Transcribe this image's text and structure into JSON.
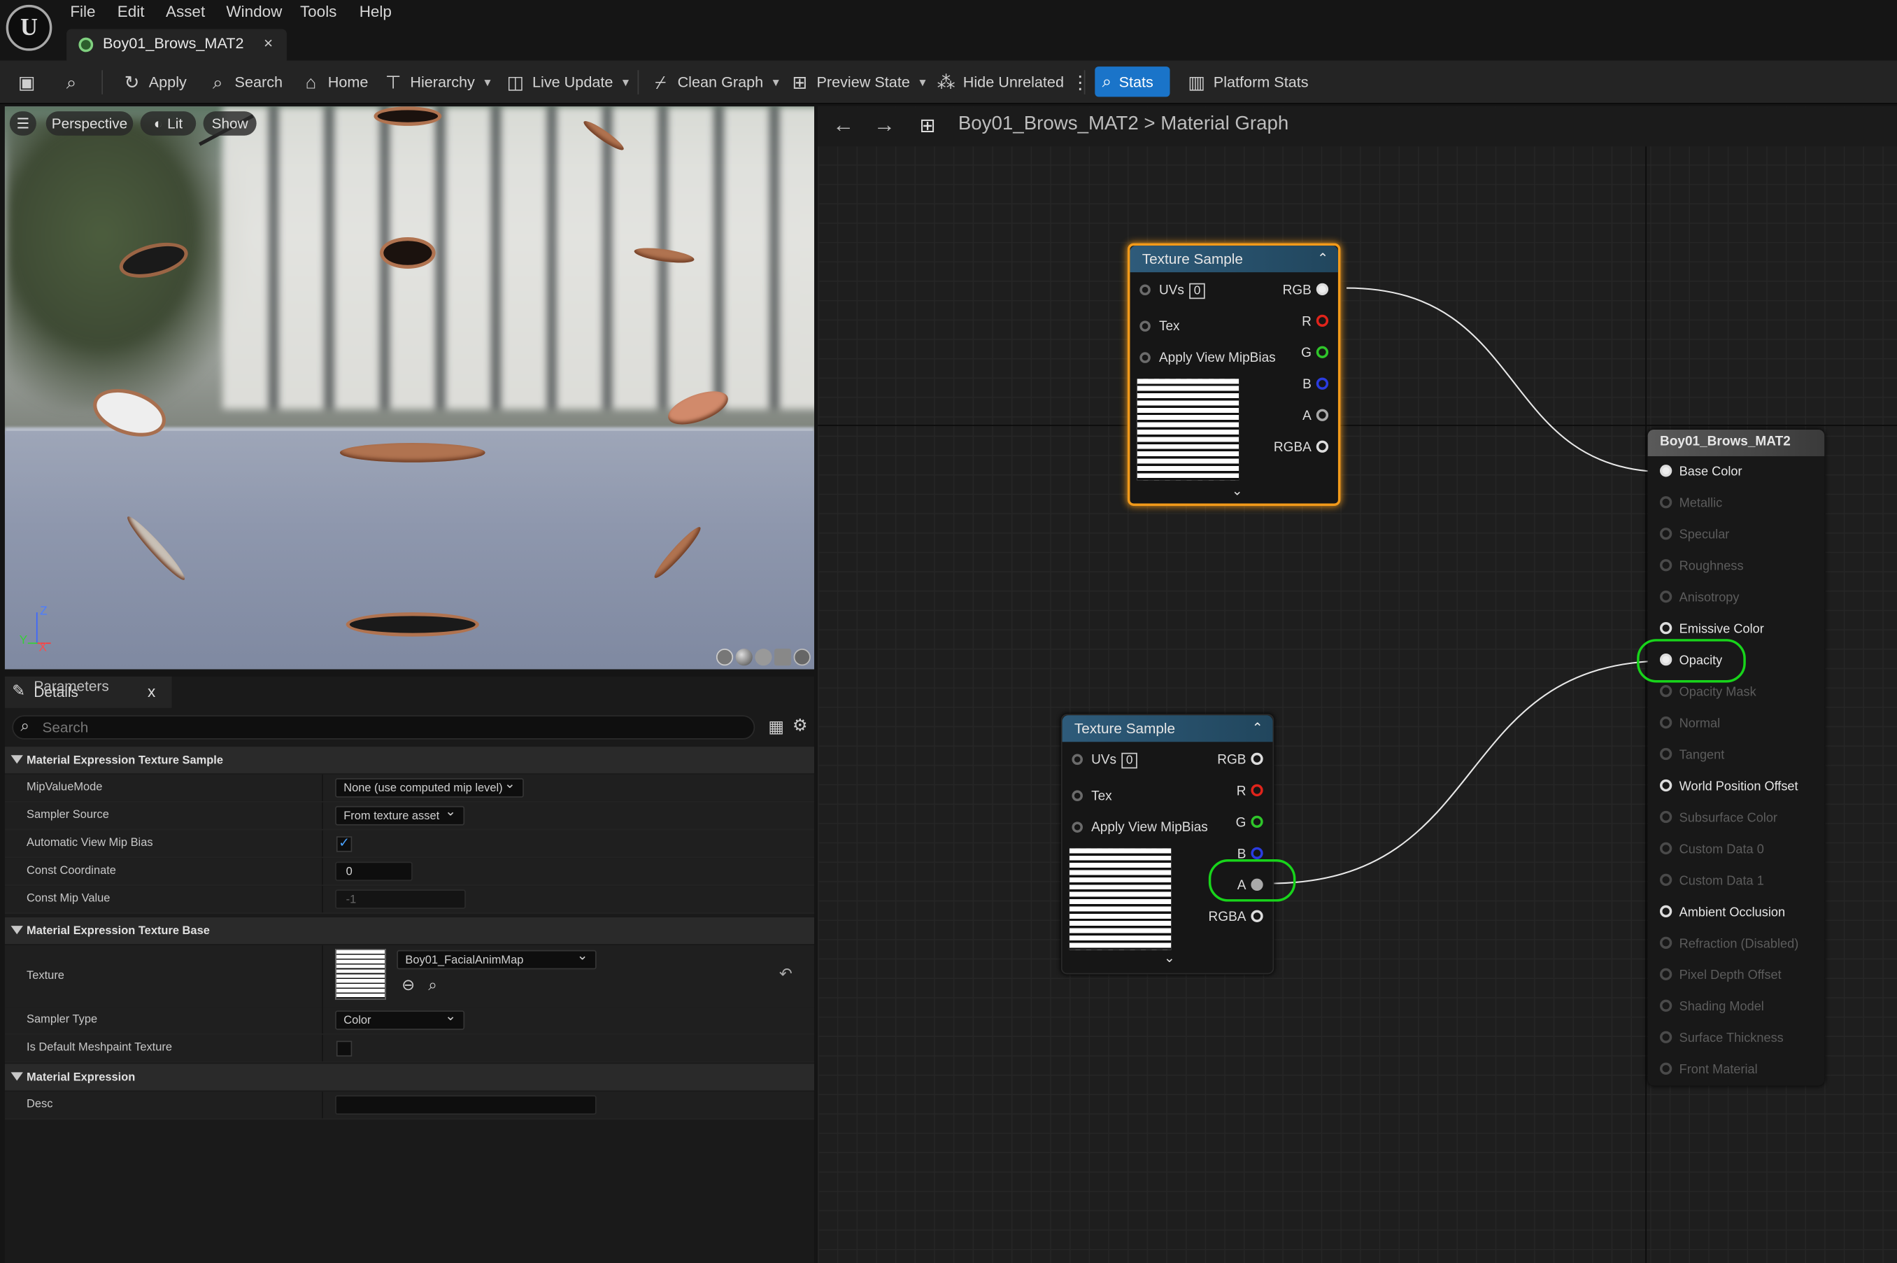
{
  "menubar": {
    "logo": "U",
    "items": [
      "File",
      "Edit",
      "Asset",
      "Window",
      "Tools",
      "Help"
    ]
  },
  "tab": {
    "title": "Boy01_Brows_MAT2",
    "close": "×"
  },
  "toolbar": {
    "apply": "Apply",
    "search": "Search",
    "home": "Home",
    "hierarchy": "Hierarchy",
    "live_update": "Live Update",
    "clean_graph": "Clean Graph",
    "preview_state": "Preview State",
    "hide_unrelated": "Hide Unrelated",
    "stats": "Stats",
    "platform_stats": "Platform Stats"
  },
  "viewport": {
    "perspective": "Perspective",
    "lit": "Lit",
    "show": "Show",
    "axis_z": "Z",
    "axis_y": "Y",
    "axis_x": "X"
  },
  "details": {
    "tab_title": "Details",
    "tab_title_overlap": "Parameters",
    "close": "x",
    "search_placeholder": "Search",
    "sections": {
      "texture_sample": "Material Expression Texture Sample",
      "texture_base": "Material Expression Texture Base",
      "expression": "Material Expression"
    },
    "rows": {
      "mip_value_mode": {
        "label": "MipValueMode",
        "value": "None (use computed mip level)"
      },
      "sampler_source": {
        "label": "Sampler Source",
        "value": "From texture asset"
      },
      "auto_view_mip_bias": {
        "label": "Automatic View Mip Bias",
        "checked": true
      },
      "const_coordinate": {
        "label": "Const Coordinate",
        "value": "0"
      },
      "const_mip_value": {
        "label": "Const Mip Value",
        "value": "-1"
      },
      "texture": {
        "label": "Texture",
        "value": "Boy01_FacialAnimMap"
      },
      "sampler_type": {
        "label": "Sampler Type",
        "value": "Color"
      },
      "default_meshpaint": {
        "label": "Is Default Meshpaint Texture",
        "checked": false
      },
      "desc": {
        "label": "Desc",
        "value": ""
      }
    }
  },
  "graph": {
    "breadcrumb_asset": "Boy01_Brows_MAT2",
    "breadcrumb_sep": ">",
    "breadcrumb_graph": "Material Graph",
    "node1": {
      "title": "Texture Sample",
      "inputs": [
        "UVs",
        "Tex",
        "Apply View MipBias"
      ],
      "uv_index": "0",
      "outputs": [
        "RGB",
        "R",
        "G",
        "B",
        "A",
        "RGBA"
      ]
    },
    "node2": {
      "title": "Texture Sample",
      "inputs": [
        "UVs",
        "Tex",
        "Apply View MipBias"
      ],
      "uv_index": "0",
      "outputs": [
        "RGB",
        "R",
        "G",
        "B",
        "A",
        "RGBA"
      ]
    },
    "material_node": {
      "title": "Boy01_Brows_MAT2",
      "inputs": [
        {
          "label": "Base Color",
          "enabled": true
        },
        {
          "label": "Metallic",
          "enabled": false
        },
        {
          "label": "Specular",
          "enabled": false
        },
        {
          "label": "Roughness",
          "enabled": false
        },
        {
          "label": "Anisotropy",
          "enabled": false
        },
        {
          "label": "Emissive Color",
          "enabled": true
        },
        {
          "label": "Opacity",
          "enabled": true
        },
        {
          "label": "Opacity Mask",
          "enabled": false
        },
        {
          "label": "Normal",
          "enabled": false
        },
        {
          "label": "Tangent",
          "enabled": false
        },
        {
          "label": "World Position Offset",
          "enabled": true
        },
        {
          "label": "Subsurface Color",
          "enabled": false
        },
        {
          "label": "Custom Data 0",
          "enabled": false
        },
        {
          "label": "Custom Data 1",
          "enabled": false
        },
        {
          "label": "Ambient Occlusion",
          "enabled": true
        },
        {
          "label": "Refraction (Disabled)",
          "enabled": false
        },
        {
          "label": "Pixel Depth Offset",
          "enabled": false
        },
        {
          "label": "Shading Model",
          "enabled": false
        },
        {
          "label": "Surface Thickness",
          "enabled": false
        },
        {
          "label": "Front Material",
          "enabled": false
        }
      ]
    },
    "colors": {
      "selected_border": "#f29a1a",
      "highlight": "#18d41b",
      "pin_r": "#e0241b",
      "pin_g": "#2fc52a",
      "pin_b": "#2a3ce0",
      "stats_button": "#1a74c9"
    }
  }
}
